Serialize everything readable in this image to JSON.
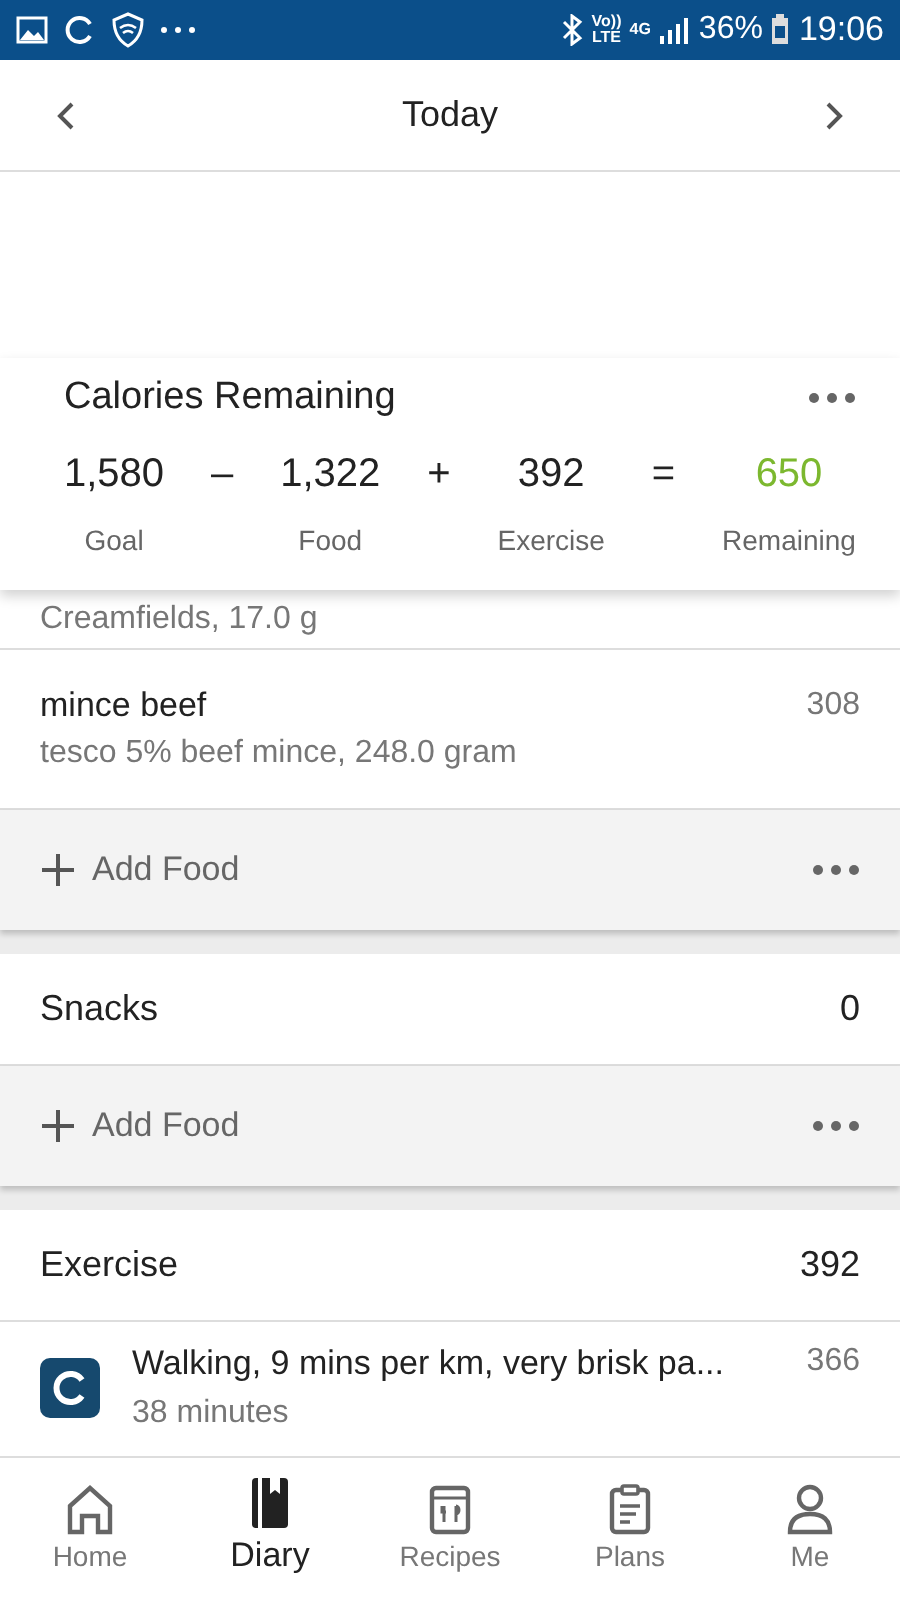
{
  "status_bar": {
    "volte": [
      "Vo))",
      "LTE"
    ],
    "network": "4G",
    "battery": "36%",
    "time": "19:06"
  },
  "header": {
    "title": "Today"
  },
  "calories": {
    "title": "Calories Remaining",
    "terms": [
      {
        "kind": "number",
        "value": "1,580",
        "label": "Goal"
      },
      {
        "kind": "operator",
        "value": "–"
      },
      {
        "kind": "number",
        "value": "1,322",
        "label": "Food"
      },
      {
        "kind": "operator",
        "value": "+"
      },
      {
        "kind": "number",
        "value": "392",
        "label": "Exercise"
      },
      {
        "kind": "operator",
        "value": "="
      },
      {
        "kind": "result",
        "value": "650",
        "label": "Remaining"
      }
    ]
  },
  "diary": [
    {
      "kind": "partial",
      "detail": "Creamfields, 17.0 g"
    },
    {
      "kind": "food",
      "name": "mince beef",
      "detail": "tesco 5% beef mince, 248.0 gram",
      "calories": "308"
    },
    {
      "kind": "add",
      "label": "Add Food"
    },
    {
      "kind": "gap"
    },
    {
      "kind": "section",
      "name": "Snacks",
      "calories": "0"
    },
    {
      "kind": "add",
      "label": "Add Food"
    },
    {
      "kind": "gap"
    },
    {
      "kind": "section",
      "name": "Exercise",
      "calories": "392"
    },
    {
      "kind": "exercise",
      "name": "Walking, 9 mins per km, very brisk pa...",
      "detail": "38 minutes",
      "calories": "366"
    }
  ],
  "nav": [
    {
      "label": "Home",
      "selected": false
    },
    {
      "label": "Diary",
      "selected": true
    },
    {
      "label": "Recipes",
      "selected": false
    },
    {
      "label": "Plans",
      "selected": false
    },
    {
      "label": "Me",
      "selected": false
    }
  ]
}
